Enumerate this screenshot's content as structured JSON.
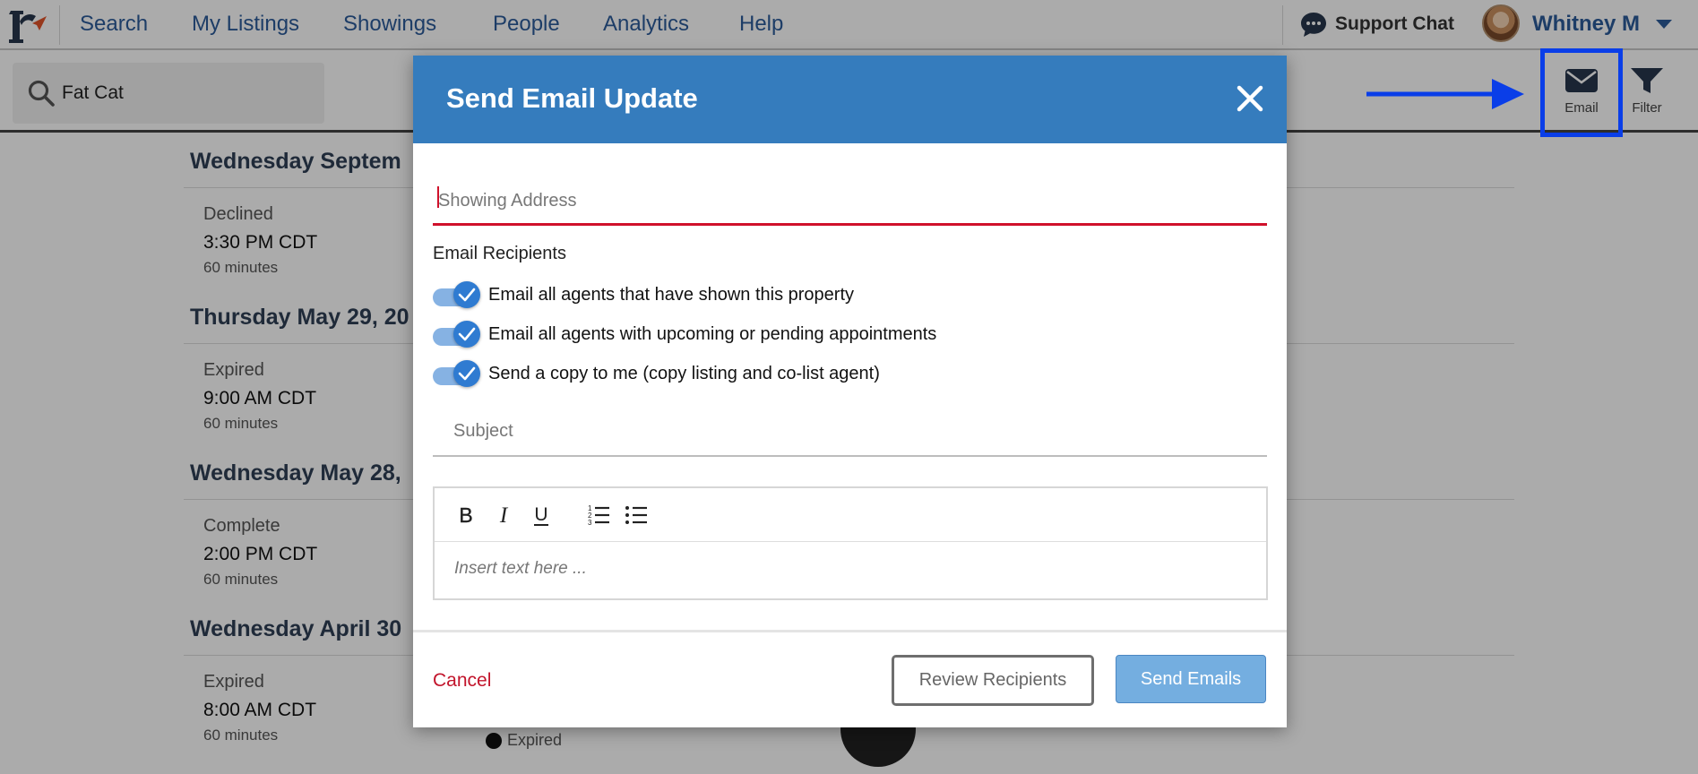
{
  "nav": {
    "items": [
      "Search",
      "My Listings",
      "Showings",
      "People",
      "Analytics",
      "Help"
    ],
    "support_label": "Support Chat",
    "user_name": "Whitney M"
  },
  "toolbar": {
    "search_value": "Fat Cat",
    "email_label": "Email",
    "filter_label": "Filter"
  },
  "list": {
    "groups": [
      {
        "heading": "Wednesday Septem",
        "status": "Declined",
        "time": "3:30 PM CDT",
        "duration": "60 minutes"
      },
      {
        "heading": "Thursday May 29, 20",
        "status": "Expired",
        "time": "9:00 AM CDT",
        "duration": "60 minutes"
      },
      {
        "heading": "Wednesday May 28,",
        "status": "Complete",
        "time": "2:00 PM CDT",
        "duration": "60 minutes"
      },
      {
        "heading": "Wednesday April 30",
        "status": "Expired",
        "time": "8:00 AM CDT",
        "duration": "60 minutes",
        "right_status": "Expired"
      }
    ]
  },
  "modal": {
    "title": "Send Email Update",
    "address_placeholder": "Showing Address",
    "recipients_label": "Email Recipients",
    "toggles": [
      {
        "label": "Email all agents that have shown this property",
        "on": true
      },
      {
        "label": "Email all agents with upcoming or pending appointments",
        "on": true
      },
      {
        "label": "Send a copy to me (copy listing and co-list agent)",
        "on": true
      }
    ],
    "subject_placeholder": "Subject",
    "editor": {
      "tools": [
        "bold-icon",
        "italic-icon",
        "underline-icon",
        "ordered-list-icon",
        "bullet-list-icon"
      ],
      "placeholder": "Insert text here ..."
    },
    "cancel_label": "Cancel",
    "review_label": "Review Recipients",
    "send_label": "Send Emails"
  },
  "colors": {
    "brand_blue": "#357cbd",
    "nav_text": "#2c5b9a",
    "danger_red": "#d0112b",
    "annotation_blue": "#0a3ee8",
    "toggle_on": "#2f7bd1",
    "send_button": "#74aee0"
  }
}
